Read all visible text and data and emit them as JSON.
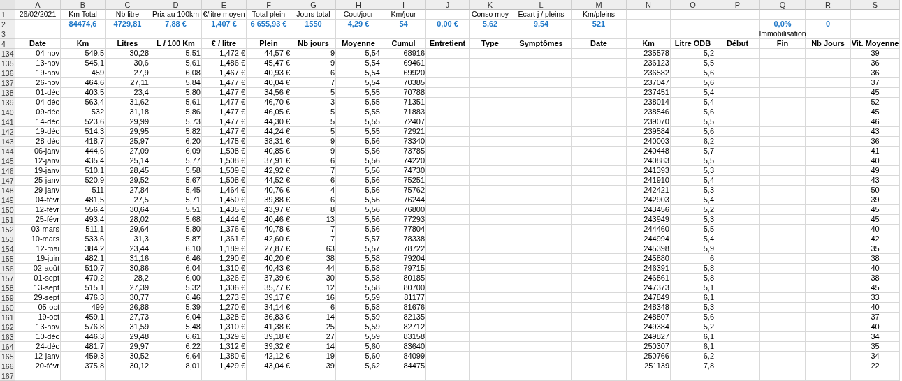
{
  "columns": [
    "A",
    "B",
    "C",
    "D",
    "E",
    "F",
    "G",
    "H",
    "I",
    "J",
    "K",
    "L",
    "M",
    "N",
    "O",
    "P",
    "Q",
    "R",
    "S"
  ],
  "rows": [
    {
      "row": "1",
      "kind": "label",
      "cells": {
        "A": "26/02/2021",
        "B": "Km Total",
        "C": "Nb litre",
        "D": "Prix au 100km",
        "E": "€/litre moyen",
        "F": "Total plein",
        "G": "Jours total",
        "H": "Cout/jour",
        "I": "Km/jour",
        "K": "Conso moy",
        "L": "Ecart j / pleins",
        "M": "Km/pleins"
      }
    },
    {
      "row": "2",
      "kind": "summary",
      "cells": {
        "B": "84474,6",
        "C": "4729,81",
        "D": "7,88 €",
        "E": "1,407 €",
        "F": "6 655,93 €",
        "G": "1550",
        "H": "4,29 €",
        "I": "54",
        "J": "0,00 €",
        "K": "5,62",
        "L": "9,54",
        "M": "521",
        "Q": "0,0%",
        "R": "0"
      }
    },
    {
      "row": "3",
      "kind": "label",
      "cells": {
        "Q": "Immobilisation"
      }
    },
    {
      "row": "4",
      "kind": "header",
      "cells": {
        "A": "Date",
        "B": "Km",
        "C": "Litres",
        "D": "L / 100 Km",
        "E": "€ / litre",
        "F": "Plein",
        "G": "Nb jours",
        "H": "Moyenne",
        "I": "Cumul",
        "J": "Entretient",
        "K": "Type",
        "L": "Symptômes",
        "M": "Date",
        "N": "Km",
        "O": "Litre ODB",
        "P": "Début",
        "Q": "Fin",
        "R": "Nb Jours",
        "S": "Vit. Moyenne"
      }
    },
    {
      "row": "134",
      "kind": "data",
      "cells": {
        "A": "04-nov",
        "B": "549,5",
        "C": "30,28",
        "D": "5,51",
        "E": "1,472 €",
        "F": "44,57 €",
        "G": "9",
        "H": "5,54",
        "I": "68916",
        "N": "235578",
        "O": "5,2",
        "S": "39"
      }
    },
    {
      "row": "135",
      "kind": "data",
      "cells": {
        "A": "13-nov",
        "B": "545,1",
        "C": "30,6",
        "D": "5,61",
        "E": "1,486 €",
        "F": "45,47 €",
        "G": "9",
        "H": "5,54",
        "I": "69461",
        "N": "236123",
        "O": "5,5",
        "S": "36"
      }
    },
    {
      "row": "136",
      "kind": "data",
      "cells": {
        "A": "19-nov",
        "B": "459",
        "C": "27,9",
        "D": "6,08",
        "E": "1,467 €",
        "F": "40,93 €",
        "G": "6",
        "H": "5,54",
        "I": "69920",
        "N": "236582",
        "O": "5,6",
        "S": "36"
      }
    },
    {
      "row": "137",
      "kind": "data",
      "cells": {
        "A": "26-nov",
        "B": "464,6",
        "C": "27,11",
        "D": "5,84",
        "E": "1,477 €",
        "F": "40,04 €",
        "G": "7",
        "H": "5,54",
        "I": "70385",
        "N": "237047",
        "O": "5,6",
        "S": "37"
      }
    },
    {
      "row": "138",
      "kind": "data",
      "cells": {
        "A": "01-déc",
        "B": "403,5",
        "C": "23,4",
        "D": "5,80",
        "E": "1,477 €",
        "F": "34,56 €",
        "G": "5",
        "H": "5,55",
        "I": "70788",
        "N": "237451",
        "O": "5,4",
        "S": "45"
      }
    },
    {
      "row": "139",
      "kind": "data",
      "cells": {
        "A": "04-déc",
        "B": "563,4",
        "C": "31,62",
        "D": "5,61",
        "E": "1,477 €",
        "F": "46,70 €",
        "G": "3",
        "H": "5,55",
        "I": "71351",
        "N": "238014",
        "O": "5,4",
        "S": "52"
      }
    },
    {
      "row": "140",
      "kind": "data",
      "cells": {
        "A": "09-déc",
        "B": "532",
        "C": "31,18",
        "D": "5,86",
        "E": "1,477 €",
        "F": "46,05 €",
        "G": "5",
        "H": "5,55",
        "I": "71883",
        "N": "238546",
        "O": "5,6",
        "S": "45"
      }
    },
    {
      "row": "141",
      "kind": "data",
      "cells": {
        "A": "14-déc",
        "B": "523,6",
        "C": "29,99",
        "D": "5,73",
        "E": "1,477 €",
        "F": "44,30 €",
        "G": "5",
        "H": "5,55",
        "I": "72407",
        "N": "239070",
        "O": "5,5",
        "S": "46"
      }
    },
    {
      "row": "142",
      "kind": "data",
      "cells": {
        "A": "19-déc",
        "B": "514,3",
        "C": "29,95",
        "D": "5,82",
        "E": "1,477 €",
        "F": "44,24 €",
        "G": "5",
        "H": "5,55",
        "I": "72921",
        "N": "239584",
        "O": "5,6",
        "S": "43"
      }
    },
    {
      "row": "143",
      "kind": "data",
      "cells": {
        "A": "28-déc",
        "B": "418,7",
        "C": "25,97",
        "D": "6,20",
        "E": "1,475 €",
        "F": "38,31 €",
        "G": "9",
        "H": "5,56",
        "I": "73340",
        "N": "240003",
        "O": "6,2",
        "S": "36"
      }
    },
    {
      "row": "144",
      "kind": "data",
      "cells": {
        "A": "06-janv",
        "B": "444,6",
        "C": "27,09",
        "D": "6,09",
        "E": "1,508 €",
        "F": "40,85 €",
        "G": "9",
        "H": "5,56",
        "I": "73785",
        "N": "240448",
        "O": "5,7",
        "S": "41"
      }
    },
    {
      "row": "145",
      "kind": "data",
      "cells": {
        "A": "12-janv",
        "B": "435,4",
        "C": "25,14",
        "D": "5,77",
        "E": "1,508 €",
        "F": "37,91 €",
        "G": "6",
        "H": "5,56",
        "I": "74220",
        "N": "240883",
        "O": "5,5",
        "S": "40"
      }
    },
    {
      "row": "146",
      "kind": "data",
      "cells": {
        "A": "19-janv",
        "B": "510,1",
        "C": "28,45",
        "D": "5,58",
        "E": "1,509 €",
        "F": "42,92 €",
        "G": "7",
        "H": "5,56",
        "I": "74730",
        "N": "241393",
        "O": "5,3",
        "S": "49"
      }
    },
    {
      "row": "147",
      "kind": "data",
      "cells": {
        "A": "25-janv",
        "B": "520,9",
        "C": "29,52",
        "D": "5,67",
        "E": "1,508 €",
        "F": "44,52 €",
        "G": "6",
        "H": "5,56",
        "I": "75251",
        "N": "241910",
        "O": "5,4",
        "S": "43"
      }
    },
    {
      "row": "148",
      "kind": "data",
      "cells": {
        "A": "29-janv",
        "B": "511",
        "C": "27,84",
        "D": "5,45",
        "E": "1,464 €",
        "F": "40,76 €",
        "G": "4",
        "H": "5,56",
        "I": "75762",
        "N": "242421",
        "O": "5,3",
        "S": "50"
      }
    },
    {
      "row": "149",
      "kind": "data",
      "cells": {
        "A": "04-févr",
        "B": "481,5",
        "C": "27,5",
        "D": "5,71",
        "E": "1,450 €",
        "F": "39,88 €",
        "G": "6",
        "H": "5,56",
        "I": "76244",
        "N": "242903",
        "O": "5,4",
        "S": "39"
      }
    },
    {
      "row": "150",
      "kind": "data",
      "cells": {
        "A": "12-févr",
        "B": "556,4",
        "C": "30,64",
        "D": "5,51",
        "E": "1,435 €",
        "F": "43,97 €",
        "G": "8",
        "H": "5,56",
        "I": "76800",
        "N": "243456",
        "O": "5,2",
        "S": "45"
      }
    },
    {
      "row": "151",
      "kind": "data",
      "cells": {
        "A": "25-févr",
        "B": "493,4",
        "C": "28,02",
        "D": "5,68",
        "E": "1,444 €",
        "F": "40,46 €",
        "G": "13",
        "H": "5,56",
        "I": "77293",
        "N": "243949",
        "O": "5,3",
        "S": "45"
      }
    },
    {
      "row": "152",
      "kind": "data",
      "cells": {
        "A": "03-mars",
        "B": "511,1",
        "C": "29,64",
        "D": "5,80",
        "E": "1,376 €",
        "F": "40,78 €",
        "G": "7",
        "H": "5,56",
        "I": "77804",
        "N": "244460",
        "O": "5,5",
        "S": "40"
      }
    },
    {
      "row": "153",
      "kind": "data",
      "cells": {
        "A": "10-mars",
        "B": "533,6",
        "C": "31,3",
        "D": "5,87",
        "E": "1,361 €",
        "F": "42,60 €",
        "G": "7",
        "H": "5,57",
        "I": "78338",
        "N": "244994",
        "O": "5,4",
        "S": "42"
      }
    },
    {
      "row": "154",
      "kind": "data",
      "cells": {
        "A": "12-mai",
        "B": "384,2",
        "C": "23,44",
        "D": "6,10",
        "E": "1,189 €",
        "F": "27,87 €",
        "G": "63",
        "H": "5,57",
        "I": "78722",
        "N": "245398",
        "O": "5,9",
        "S": "35"
      }
    },
    {
      "row": "155",
      "kind": "data",
      "cells": {
        "A": "19-juin",
        "B": "482,1",
        "C": "31,16",
        "D": "6,46",
        "E": "1,290 €",
        "F": "40,20 €",
        "G": "38",
        "H": "5,58",
        "I": "79204",
        "N": "245880",
        "O": "6",
        "S": "38"
      }
    },
    {
      "row": "156",
      "kind": "data",
      "cells": {
        "A": "02-août",
        "B": "510,7",
        "C": "30,86",
        "D": "6,04",
        "E": "1,310 €",
        "F": "40,43 €",
        "G": "44",
        "H": "5,58",
        "I": "79715",
        "N": "246391",
        "O": "5,8",
        "S": "40"
      }
    },
    {
      "row": "157",
      "kind": "data",
      "cells": {
        "A": "01-sept",
        "B": "470,2",
        "C": "28,2",
        "D": "6,00",
        "E": "1,326 €",
        "F": "37,39 €",
        "G": "30",
        "H": "5,58",
        "I": "80185",
        "N": "246861",
        "O": "5,8",
        "S": "38"
      }
    },
    {
      "row": "158",
      "kind": "data",
      "cells": {
        "A": "13-sept",
        "B": "515,1",
        "C": "27,39",
        "D": "5,32",
        "E": "1,306 €",
        "F": "35,77 €",
        "G": "12",
        "H": "5,58",
        "I": "80700",
        "N": "247373",
        "O": "5,1",
        "S": "45"
      }
    },
    {
      "row": "159",
      "kind": "data",
      "cells": {
        "A": "29-sept",
        "B": "476,3",
        "C": "30,77",
        "D": "6,46",
        "E": "1,273 €",
        "F": "39,17 €",
        "G": "16",
        "H": "5,59",
        "I": "81177",
        "N": "247849",
        "O": "6,1",
        "S": "33"
      }
    },
    {
      "row": "160",
      "kind": "data",
      "cells": {
        "A": "05-oct",
        "B": "499",
        "C": "26,88",
        "D": "5,39",
        "E": "1,270 €",
        "F": "34,14 €",
        "G": "6",
        "H": "5,58",
        "I": "81676",
        "N": "248348",
        "O": "5,3",
        "S": "40"
      }
    },
    {
      "row": "161",
      "kind": "data",
      "cells": {
        "A": "19-oct",
        "B": "459,1",
        "C": "27,73",
        "D": "6,04",
        "E": "1,328 €",
        "F": "36,83 €",
        "G": "14",
        "H": "5,59",
        "I": "82135",
        "N": "248807",
        "O": "5,6",
        "S": "37"
      }
    },
    {
      "row": "162",
      "kind": "data",
      "cells": {
        "A": "13-nov",
        "B": "576,8",
        "C": "31,59",
        "D": "5,48",
        "E": "1,310 €",
        "F": "41,38 €",
        "G": "25",
        "H": "5,59",
        "I": "82712",
        "N": "249384",
        "O": "5,2",
        "S": "40"
      }
    },
    {
      "row": "163",
      "kind": "data",
      "cells": {
        "A": "10-déc",
        "B": "446,3",
        "C": "29,48",
        "D": "6,61",
        "E": "1,329 €",
        "F": "39,18 €",
        "G": "27",
        "H": "5,59",
        "I": "83158",
        "N": "249827",
        "O": "6,1",
        "S": "34"
      }
    },
    {
      "row": "164",
      "kind": "data",
      "cells": {
        "A": "24-déc",
        "B": "481,7",
        "C": "29,97",
        "D": "6,22",
        "E": "1,312 €",
        "F": "39,32 €",
        "G": "14",
        "H": "5,60",
        "I": "83640",
        "N": "250307",
        "O": "6,1",
        "S": "35"
      }
    },
    {
      "row": "165",
      "kind": "data",
      "cells": {
        "A": "12-janv",
        "B": "459,3",
        "C": "30,52",
        "D": "6,64",
        "E": "1,380 €",
        "F": "42,12 €",
        "G": "19",
        "H": "5,60",
        "I": "84099",
        "N": "250766",
        "O": "6,2",
        "S": "34"
      }
    },
    {
      "row": "166",
      "kind": "data",
      "cells": {
        "A": "20-févr",
        "B": "375,8",
        "C": "30,12",
        "D": "8,01",
        "E": "1,429 €",
        "F": "43,04 €",
        "G": "39",
        "H": "5,62",
        "I": "84475",
        "N": "251139",
        "O": "7,8",
        "S": "22"
      }
    },
    {
      "row": "167",
      "kind": "data",
      "cells": {}
    }
  ]
}
